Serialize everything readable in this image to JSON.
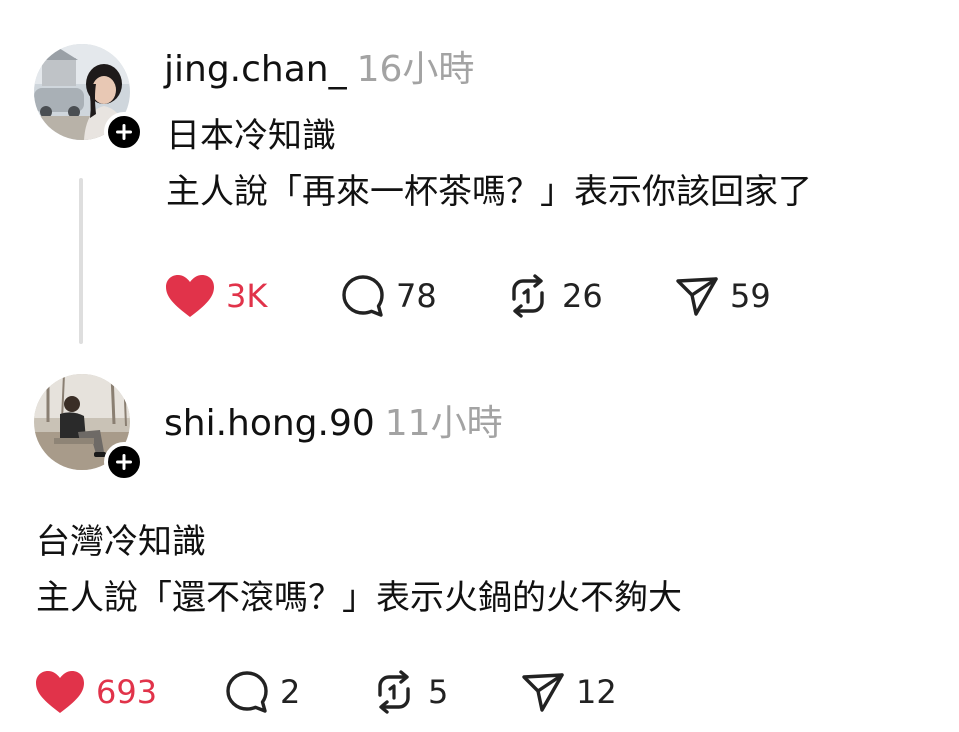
{
  "colors": {
    "like_red": "#e1334a",
    "muted_gray": "#a3a3a3",
    "thread_line": "#dedede"
  },
  "icons": {
    "like": "heart-icon",
    "comment": "comment-icon",
    "repost": "repost-icon",
    "share": "share-icon",
    "follow": "plus-icon"
  },
  "posts": [
    {
      "username": "jing.chan_",
      "time": "16小時",
      "lines": [
        "日本冷知識",
        "主人說「再來一杯茶嗎？」表示你該回家了"
      ],
      "likes": "3K",
      "comments": "78",
      "reposts": "26",
      "shares": "59",
      "liked": true
    },
    {
      "username": "shi.hong.90",
      "time": "11小時",
      "lines": [
        "台灣冷知識",
        "主人說「還不滾嗎？」表示火鍋的火不夠大"
      ],
      "likes": "693",
      "comments": "2",
      "reposts": "5",
      "shares": "12",
      "liked": true
    }
  ]
}
